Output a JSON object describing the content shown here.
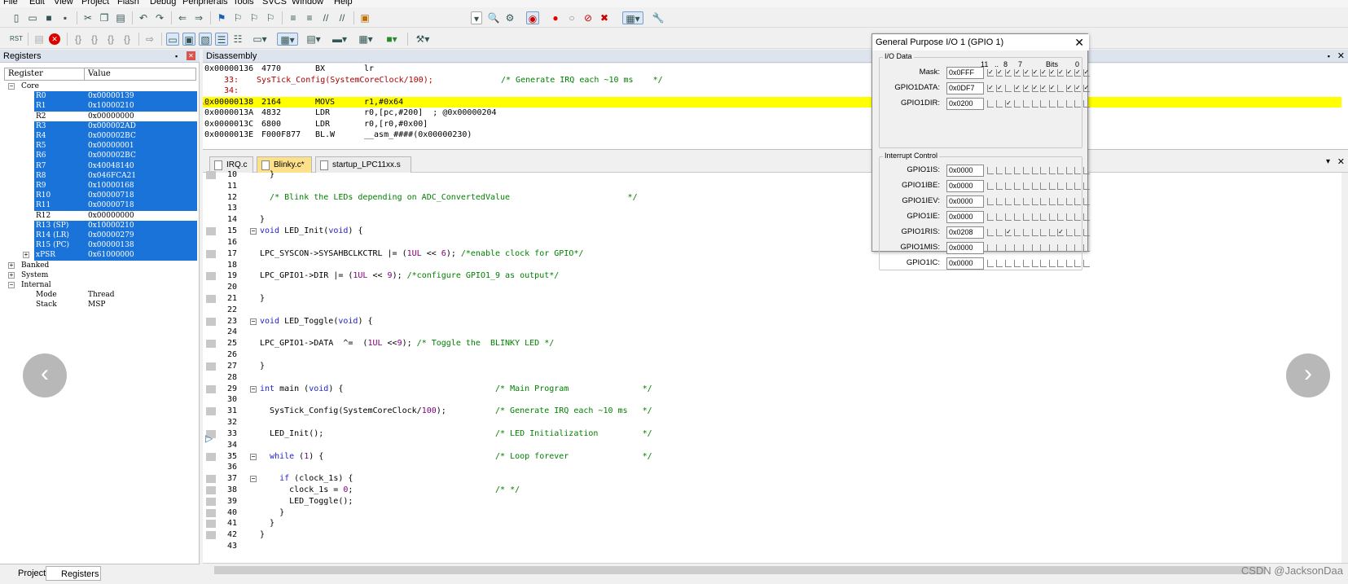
{
  "menu": [
    "File",
    "Edit",
    "View",
    "Project",
    "Flash",
    "Debug",
    "Peripherals",
    "Tools",
    "SVCS",
    "Window",
    "Help"
  ],
  "registers_pane": {
    "title": "Registers",
    "col_register": "Register",
    "col_value": "Value",
    "groups": {
      "core": "Core",
      "banked": "Banked",
      "system": "System",
      "internal": "Internal"
    },
    "rows": [
      {
        "name": "R0",
        "value": "0x00000139",
        "sel": true
      },
      {
        "name": "R1",
        "value": "0x10000210",
        "sel": true
      },
      {
        "name": "R2",
        "value": "0x00000000",
        "sel": false
      },
      {
        "name": "R3",
        "value": "0x000002AD",
        "sel": true
      },
      {
        "name": "R4",
        "value": "0x000002BC",
        "sel": true
      },
      {
        "name": "R5",
        "value": "0x00000001",
        "sel": true
      },
      {
        "name": "R6",
        "value": "0x000002BC",
        "sel": true
      },
      {
        "name": "R7",
        "value": "0x40048140",
        "sel": true
      },
      {
        "name": "R8",
        "value": "0x046FCA21",
        "sel": true
      },
      {
        "name": "R9",
        "value": "0x10000168",
        "sel": true
      },
      {
        "name": "R10",
        "value": "0x00000718",
        "sel": true
      },
      {
        "name": "R11",
        "value": "0x00000718",
        "sel": true
      },
      {
        "name": "R12",
        "value": "0x00000000",
        "sel": false
      },
      {
        "name": "R13 (SP)",
        "value": "0x10000210",
        "sel": true
      },
      {
        "name": "R14 (LR)",
        "value": "0x00000279",
        "sel": true
      },
      {
        "name": "R15 (PC)",
        "value": "0x00000138",
        "sel": true
      },
      {
        "name": "xPSR",
        "value": "0x61000000",
        "sel": true
      }
    ],
    "internal": [
      {
        "name": "Mode",
        "value": "Thread"
      },
      {
        "name": "Stack",
        "value": "MSP"
      }
    ],
    "tabs": [
      "Project",
      "Registers"
    ]
  },
  "disassembly": {
    "title": "Disassembly",
    "lines": [
      {
        "addr": "0x00000136",
        "op": "4770",
        "mn": "BX",
        "args": "lr",
        "hl": false,
        "src": false
      },
      {
        "addr": "",
        "op": "33:",
        "mn": "SysTick_Config(SystemCoreClock/100);",
        "args": "/* Generate IRQ each ~10 ms    */",
        "hl": false,
        "src": true
      },
      {
        "addr": "",
        "op": "34:",
        "mn": "",
        "args": "",
        "hl": false,
        "src": true
      },
      {
        "addr": "0x00000138",
        "op": "2164",
        "mn": "MOVS",
        "args": "r1,#0x64",
        "hl": true,
        "src": false
      },
      {
        "addr": "0x0000013A",
        "op": "4832",
        "mn": "LDR",
        "args": "r0,[pc,#200]  ; @0x00000204",
        "hl": false,
        "src": false
      },
      {
        "addr": "0x0000013C",
        "op": "6800",
        "mn": "LDR",
        "args": "r0,[r0,#0x00]",
        "hl": false,
        "src": false
      },
      {
        "addr": "0x0000013E",
        "op": "F000F877",
        "mn": "BL.W",
        "args": "__asm_####(0x00000230)",
        "hl": false,
        "src": false
      }
    ]
  },
  "editor_tabs": [
    {
      "label": "IRQ.c",
      "active": false
    },
    {
      "label": "Blinky.c*",
      "active": true
    },
    {
      "label": "startup_LPC11xx.s",
      "active": false
    }
  ],
  "code_lines": [
    {
      "n": "10",
      "t": "  }",
      "m": true,
      "f": ""
    },
    {
      "n": "11",
      "t": "",
      "m": false,
      "f": ""
    },
    {
      "n": "12",
      "t": "  /* Blink the LEDs depending on ADC_ConvertedValue                        */",
      "m": false,
      "f": ""
    },
    {
      "n": "13",
      "t": "",
      "m": false,
      "f": ""
    },
    {
      "n": "14",
      "t": "}",
      "m": false,
      "f": ""
    },
    {
      "n": "15",
      "t": "void LED_Init(void) {",
      "m": true,
      "f": "-"
    },
    {
      "n": "16",
      "t": "",
      "m": false,
      "f": ""
    },
    {
      "n": "17",
      "t": "LPC_SYSCON->SYSAHBCLKCTRL |= (1UL << 6); /*enable clock for GPIO*/",
      "m": true,
      "f": ""
    },
    {
      "n": "18",
      "t": "",
      "m": false,
      "f": ""
    },
    {
      "n": "19",
      "t": "LPC_GPIO1->DIR |= (1UL << 9); /*configure GPIO1_9 as output*/",
      "m": true,
      "f": ""
    },
    {
      "n": "20",
      "t": "",
      "m": false,
      "f": ""
    },
    {
      "n": "21",
      "t": "}",
      "m": true,
      "f": ""
    },
    {
      "n": "22",
      "t": "",
      "m": false,
      "f": ""
    },
    {
      "n": "23",
      "t": "void LED_Toggle(void) {",
      "m": true,
      "f": "-"
    },
    {
      "n": "24",
      "t": "",
      "m": false,
      "f": ""
    },
    {
      "n": "25",
      "t": "LPC_GPIO1->DATA  ^=  (1UL <<9); /* Toggle the  BLINKY LED */",
      "m": true,
      "f": ""
    },
    {
      "n": "26",
      "t": "",
      "m": false,
      "f": ""
    },
    {
      "n": "27",
      "t": "}",
      "m": true,
      "f": ""
    },
    {
      "n": "28",
      "t": "",
      "m": false,
      "f": ""
    },
    {
      "n": "29",
      "t": "int main (void) {                               /* Main Program               */",
      "m": true,
      "f": "-"
    },
    {
      "n": "30",
      "t": "",
      "m": false,
      "f": ""
    },
    {
      "n": "31",
      "t": "  SysTick_Config(SystemCoreClock/100);          /* Generate IRQ each ~10 ms   */",
      "m": true,
      "f": ""
    },
    {
      "n": "32",
      "t": "",
      "m": false,
      "f": ""
    },
    {
      "n": "33",
      "t": "  LED_Init();                                   /* LED Initialization         */",
      "m": true,
      "f": ""
    },
    {
      "n": "34",
      "t": "",
      "m": false,
      "f": ""
    },
    {
      "n": "35",
      "t": "  while (1) {                                   /* Loop forever               */",
      "m": true,
      "f": "-"
    },
    {
      "n": "36",
      "t": "",
      "m": false,
      "f": ""
    },
    {
      "n": "37",
      "t": "    if (clock_1s) {",
      "m": true,
      "f": "-"
    },
    {
      "n": "38",
      "t": "      clock_1s = 0;                             /* */",
      "m": true,
      "f": ""
    },
    {
      "n": "39",
      "t": "      LED_Toggle();",
      "m": true,
      "f": ""
    },
    {
      "n": "40",
      "t": "    }",
      "m": true,
      "f": ""
    },
    {
      "n": "41",
      "t": "  }",
      "m": true,
      "f": ""
    },
    {
      "n": "42",
      "t": "}",
      "m": true,
      "f": ""
    },
    {
      "n": "43",
      "t": "",
      "m": false,
      "f": ""
    }
  ],
  "gpio_dialog": {
    "title": "General Purpose I/O 1 (GPIO 1)",
    "io_group": "I/O Data",
    "bits_header": {
      "b11": "11",
      "dots": "..",
      "b8": "8",
      "b7": "7",
      "bits": "Bits",
      "b0": "0"
    },
    "io_rows": [
      {
        "label": "Mask:",
        "value": "0x0FFF",
        "checks": [
          1,
          1,
          1,
          1,
          1,
          1,
          1,
          1,
          1,
          1,
          1,
          1
        ]
      },
      {
        "label": "GPIO1DATA:",
        "value": "0x0DF7",
        "checks": [
          1,
          1,
          0,
          1,
          1,
          1,
          1,
          1,
          0,
          1,
          1,
          1
        ]
      },
      {
        "label": "GPIO1DIR:",
        "value": "0x0200",
        "checks": [
          0,
          0,
          1,
          0,
          0,
          0,
          0,
          0,
          0,
          0,
          0,
          0
        ]
      }
    ],
    "int_group": "Interrupt Control",
    "int_rows": [
      {
        "label": "GPIO1IS:",
        "value": "0x0000",
        "checks": [
          0,
          0,
          0,
          0,
          0,
          0,
          0,
          0,
          0,
          0,
          0,
          0
        ]
      },
      {
        "label": "GPIO1IBE:",
        "value": "0x0000",
        "checks": [
          0,
          0,
          0,
          0,
          0,
          0,
          0,
          0,
          0,
          0,
          0,
          0
        ]
      },
      {
        "label": "GPIO1IEV:",
        "value": "0x0000",
        "checks": [
          0,
          0,
          0,
          0,
          0,
          0,
          0,
          0,
          0,
          0,
          0,
          0
        ]
      },
      {
        "label": "GPIO1IE:",
        "value": "0x0000",
        "checks": [
          0,
          0,
          0,
          0,
          0,
          0,
          0,
          0,
          0,
          0,
          0,
          0
        ]
      },
      {
        "label": "GPIO1RIS:",
        "value": "0x0208",
        "checks": [
          0,
          0,
          1,
          0,
          0,
          0,
          0,
          0,
          1,
          0,
          0,
          0
        ]
      },
      {
        "label": "GPIO1MIS:",
        "value": "0x0000",
        "checks": [
          0,
          0,
          0,
          0,
          0,
          0,
          0,
          0,
          0,
          0,
          0,
          0
        ]
      },
      {
        "label": "GPIO1IC:",
        "value": "0x0000",
        "checks": [
          0,
          0,
          0,
          0,
          0,
          0,
          0,
          0,
          0,
          0,
          0,
          0
        ]
      }
    ]
  },
  "watermark": "CSDN @JacksonDaa",
  "colors": {
    "selection": "#1a73d9",
    "current_line": "#ffff00",
    "comment": "#008000",
    "keyword": "#2222cc"
  }
}
